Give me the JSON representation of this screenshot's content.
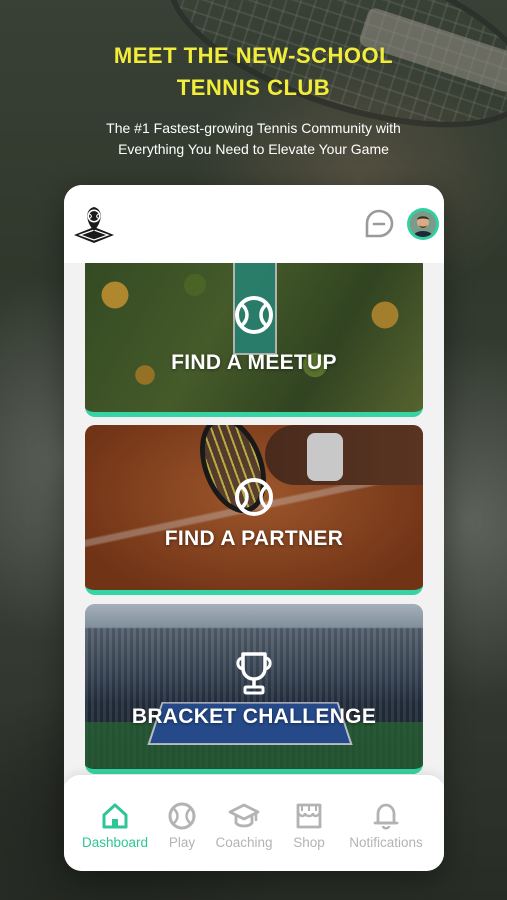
{
  "hero": {
    "headline_line1": "MEET THE NEW-SCHOOL",
    "headline_line2": "TENNIS CLUB",
    "subline_line1": "The #1 Fastest-growing Tennis Community with",
    "subline_line2": "Everything You Need to Elevate Your Game"
  },
  "colors": {
    "headline": "#f2ec3a",
    "accent": "#2fc596",
    "card_underline": "#36d4a4",
    "nav_inactive": "#b3b3b3"
  },
  "app_header": {
    "logo_icon": "tennis-court-pin-logo",
    "chat_icon": "chat-bubble-icon",
    "avatar": "user-avatar"
  },
  "feature_cards": [
    {
      "label": "FIND A MEETUP",
      "icon": "tennis-ball-icon"
    },
    {
      "label": "FIND A PARTNER",
      "icon": "tennis-ball-icon"
    },
    {
      "label": "BRACKET CHALLENGE",
      "icon": "trophy-icon"
    }
  ],
  "bottom_nav": {
    "active": "Dashboard",
    "items": [
      {
        "label": "Dashboard",
        "icon": "home-icon"
      },
      {
        "label": "Play",
        "icon": "tennis-ball-icon"
      },
      {
        "label": "Coaching",
        "icon": "graduation-cap-icon"
      },
      {
        "label": "Shop",
        "icon": "shop-icon"
      },
      {
        "label": "Notifications",
        "icon": "bell-icon"
      }
    ]
  }
}
